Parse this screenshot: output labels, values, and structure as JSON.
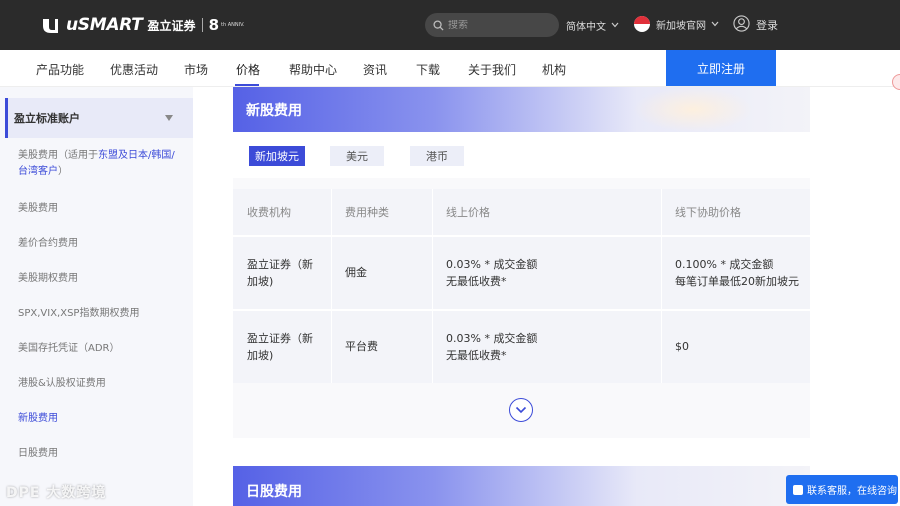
{
  "header": {
    "brand": "uSMART",
    "brand_cn": "盈立证券",
    "anniversary_num": "8",
    "anniversary_sub": "th ANNIV.",
    "search_placeholder": "搜索",
    "language": "简体中文",
    "region": "新加坡官网",
    "login": "登录"
  },
  "nav": {
    "items": [
      "产品功能",
      "优惠活动",
      "市场",
      "价格",
      "帮助中心",
      "资讯",
      "下载",
      "关于我们",
      "机构"
    ],
    "active": "价格",
    "register": "立即注册"
  },
  "sidebar": {
    "account": "盈立标准账户",
    "items": [
      {
        "label": "美股费用（适用于",
        "label_hl": "东盟及日本/韩国/台湾客户",
        "label_end": "）"
      },
      {
        "label": "美股费用"
      },
      {
        "label": "差价合约费用"
      },
      {
        "label": "美股期权费用"
      },
      {
        "label": "SPX,VIX,XSP指数期权费用"
      },
      {
        "label": "美国存托凭证（ADR）"
      },
      {
        "label": "港股&认股权证费用"
      },
      {
        "label": "新股费用"
      },
      {
        "label": "日股费用"
      }
    ],
    "active_index": 7
  },
  "section1": {
    "title": "新股费用",
    "currencies": [
      "新加坡元",
      "美元",
      "港币"
    ],
    "active_currency": "新加坡元",
    "columns": [
      "收费机构",
      "费用种类",
      "线上价格",
      "线下协助价格"
    ],
    "rows": [
      {
        "org": [
          "盈立证券（新",
          "加坡)"
        ],
        "type": "佣金",
        "online": [
          "0.03% * 成交金额",
          "无最低收费*"
        ],
        "offline": [
          "0.100% * 成交金额",
          "每笔订单最低20新加坡元"
        ]
      },
      {
        "org": [
          "盈立证券（新",
          "加坡)"
        ],
        "type": "平台费",
        "online": [
          "0.03% * 成交金额",
          "无最低收费*"
        ],
        "offline": [
          "$0",
          ""
        ]
      }
    ]
  },
  "section2": {
    "title": "日股费用"
  },
  "support": {
    "label": "联系客服，在线咨询"
  },
  "watermark": "DPE 大数跨境",
  "colors": {
    "accent": "#3c4bd8",
    "topbar": "#2b2b2b",
    "register": "#1f6ef0"
  }
}
